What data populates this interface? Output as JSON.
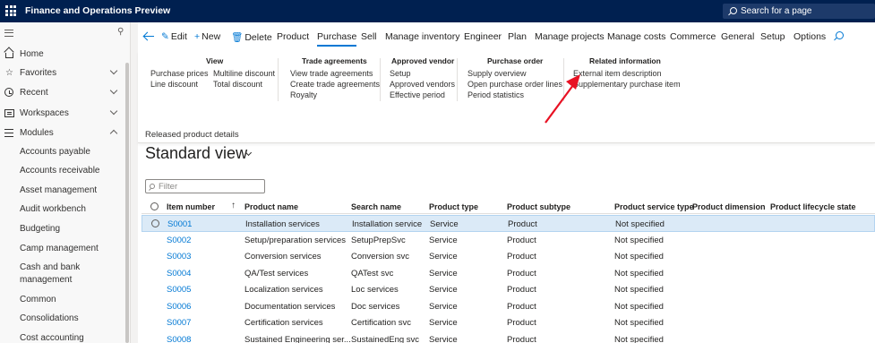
{
  "app": {
    "title": "Finance and Operations Preview",
    "search_placeholder": "Search for a page"
  },
  "nav": {
    "top_items": [
      {
        "label": "Home",
        "icon": "home-icon"
      },
      {
        "label": "Favorites",
        "icon": "star-icon"
      },
      {
        "label": "Recent",
        "icon": "clock-icon"
      },
      {
        "label": "Workspaces",
        "icon": "workspaces-icon"
      },
      {
        "label": "Modules",
        "icon": "modules-icon"
      }
    ],
    "modules": [
      "Accounts payable",
      "Accounts receivable",
      "Asset management",
      "Audit workbench",
      "Budgeting",
      "Camp management",
      "Cash and bank management",
      "Common",
      "Consolidations",
      "Cost accounting"
    ]
  },
  "actionbar": {
    "edit": "Edit",
    "new": "New",
    "delete": "Delete",
    "tabs": [
      "Product",
      "Purchase",
      "Sell",
      "Manage inventory",
      "Engineer",
      "Plan",
      "Manage projects",
      "Manage costs",
      "Commerce",
      "General",
      "Setup",
      "Options"
    ],
    "active_tab": "Purchase"
  },
  "ribbon": {
    "view": {
      "title": "View",
      "col1": [
        "Purchase prices",
        "Line discount"
      ],
      "col2": [
        "Multiline discount",
        "Total discount"
      ]
    },
    "trade": {
      "title": "Trade agreements",
      "items": [
        "View trade agreements",
        "Create trade agreements",
        "Royalty"
      ]
    },
    "vendor": {
      "title": "Approved vendor",
      "items": [
        "Setup",
        "Approved vendors",
        "Effective period"
      ]
    },
    "po": {
      "title": "Purchase order",
      "items": [
        "Supply overview",
        "Open purchase order lines",
        "Period statistics"
      ]
    },
    "related": {
      "title": "Related information",
      "items": [
        "External item description",
        "Supplementary purchase item"
      ]
    }
  },
  "page": {
    "breadcrumb": "Released product details",
    "view_name": "Standard view",
    "filter_placeholder": "Filter"
  },
  "grid": {
    "columns": [
      "Item number",
      "Product name",
      "Search name",
      "Product type",
      "Product subtype",
      "Product service type",
      "Product dimension ...",
      "Product lifecycle state"
    ],
    "rows": [
      [
        "S0001",
        "Installation services",
        "Installation service",
        "Service",
        "Product",
        "Not specified"
      ],
      [
        "S0002",
        "Setup/preparation services",
        "SetupPrepSvc",
        "Service",
        "Product",
        "Not specified"
      ],
      [
        "S0003",
        "Conversion services",
        "Conversion svc",
        "Service",
        "Product",
        "Not specified"
      ],
      [
        "S0004",
        "QA/Test services",
        "QATest svc",
        "Service",
        "Product",
        "Not specified"
      ],
      [
        "S0005",
        "Localization services",
        "Loc services",
        "Service",
        "Product",
        "Not specified"
      ],
      [
        "S0006",
        "Documentation services",
        "Doc services",
        "Service",
        "Product",
        "Not specified"
      ],
      [
        "S0007",
        "Certification services",
        "Certification svc",
        "Service",
        "Product",
        "Not specified"
      ],
      [
        "S0008",
        "Sustained Engineering ser...",
        "SustainedEng svc",
        "Service",
        "Product",
        "Not specified"
      ]
    ]
  },
  "colors": {
    "topbar": "#002050",
    "accent": "#0078d4",
    "selected_row": "#dbeaf7",
    "annotation_arrow": "#e81123"
  }
}
